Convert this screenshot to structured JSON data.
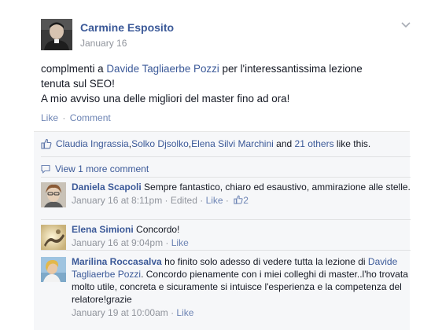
{
  "post": {
    "author": "Carmine Esposito",
    "date": "January 16",
    "body_line1_pre": "complmenti a ",
    "body_mention": "Davide Tagliaerbe Pozzi",
    "body_line1_post": " per l'interessantissima lezione",
    "body_line2": "tenuta sul SEO!",
    "body_line3": "A mio avviso una delle migliori del master fino ad ora!",
    "action_like": "Like",
    "action_comment": "Comment",
    "action_separator": "·",
    "chevron_icon": "chevron-down-icon"
  },
  "likes": {
    "name1": "Claudia Ingrassia",
    "comma1": ", ",
    "name2": "Solko Djsolko",
    "comma2": ", ",
    "name3": "Elena Silvi Marchini",
    "and_text": " and ",
    "others": "21 others",
    "suffix": " like this.",
    "icon": "thumbs-up-icon"
  },
  "more_comments": {
    "label": "View 1 more comment",
    "icon": "comment-bubble-icon"
  },
  "comments": [
    {
      "name": "Daniela Scapoli",
      "text": " Sempre fantastico, chiaro ed esaustivo, ammirazione alle stelle.",
      "time": "January 16 at 8:11pm",
      "edited": "Edited",
      "like": "Like",
      "like_count": "2",
      "sep": " · "
    },
    {
      "name": "Elena Simioni",
      "text": " Concordo!",
      "time": "January 16 at 9:04pm",
      "like": "Like",
      "sep": " · "
    },
    {
      "name": "Marilina Roccasalva",
      "text_pre": " ho finito solo adesso di vedere tutta la lezione di ",
      "mention": "Davide Tagliaerbe Pozzi",
      "text_post": ". Concordo pienamente con i miei colleghi di master..l'ho trovata molto utile, concreta e sicuramente si intuisce l'esperienza e la competenza del relatore!grazie",
      "time": "January 19 at 10:00am",
      "like": "Like",
      "sep": " · "
    }
  ],
  "colors": {
    "link": "#3b5998",
    "muted": "#90949c",
    "ufi_bg": "#f6f7f9"
  }
}
